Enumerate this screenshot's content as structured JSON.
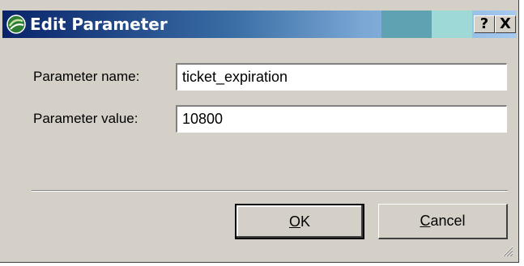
{
  "dialog": {
    "title": "Edit Parameter",
    "help_button": "?",
    "close_button": "X"
  },
  "form": {
    "name_label": "Parameter name:",
    "name_value": "ticket_expiration",
    "value_label": "Parameter value:",
    "value_value": "10800"
  },
  "buttons": {
    "ok_mnemonic": "O",
    "ok_rest": "K",
    "cancel_mnemonic": "C",
    "cancel_rest": "ancel"
  },
  "icons": {
    "app": "globe-icon",
    "grip": "resize-grip-icon"
  },
  "colors": {
    "face": "#d4d0c8",
    "title_start": "#0a246a",
    "title_end": "#a6caf0"
  }
}
